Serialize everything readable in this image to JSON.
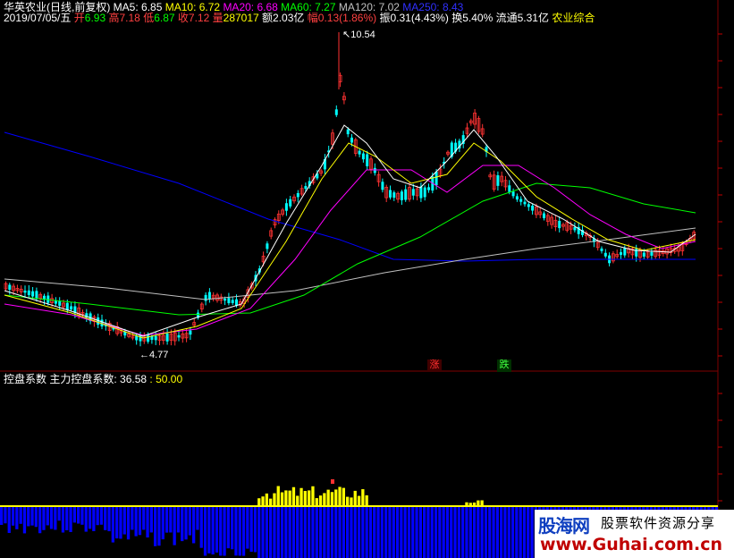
{
  "header": {
    "stock_name": "华英农业(日线,前复权)",
    "ma5": "MA5: 6.85",
    "ma10": "MA10: 6.72",
    "ma20": "MA20: 6.68",
    "ma60": "MA60: 7.27",
    "ma120": "MA120: 7.02",
    "ma250": "MA250: 8.43"
  },
  "info": {
    "date": "2019/07/05/五",
    "open_label": "开",
    "open": "6.93",
    "high_label": "高",
    "high": "7.18",
    "low_label": "低",
    "low": "6.87",
    "close_label": "收",
    "close": "7.12",
    "volume_label": "量",
    "volume": "287017",
    "amount_label": "额",
    "amount": "2.03亿",
    "change_label": "幅",
    "change": "0.13(1.86%)",
    "amplitude_label": "振",
    "amplitude": "0.31(4.43%)",
    "turnover_label": "换",
    "turnover": "5.40%",
    "float_label": "流通",
    "float": "5.31亿",
    "sector": "农业综合"
  },
  "annotations": {
    "high_price": "10.54",
    "low_price": "4.77",
    "rise_marker": "涨",
    "fall_marker": "跌"
  },
  "indicator": {
    "name": "控盘系数",
    "series_name": "主力控盘系数",
    "value": "36.58",
    "level": "50.00"
  },
  "watermark": {
    "logo": "股海网",
    "slogan": "股票软件资源分享",
    "url": "www.Guhai.com.cn"
  },
  "colors": {
    "background": "#000000",
    "up": "#ff3232",
    "down": "#00ffff",
    "ma5": "#ffffff",
    "ma10": "#ffff00",
    "ma20": "#ff00ff",
    "ma60": "#00ff00",
    "ma120": "#c0c0c0",
    "ma250": "#0000ff",
    "bars_positive": "#ffff00",
    "bars_negative": "#0000ff"
  }
}
